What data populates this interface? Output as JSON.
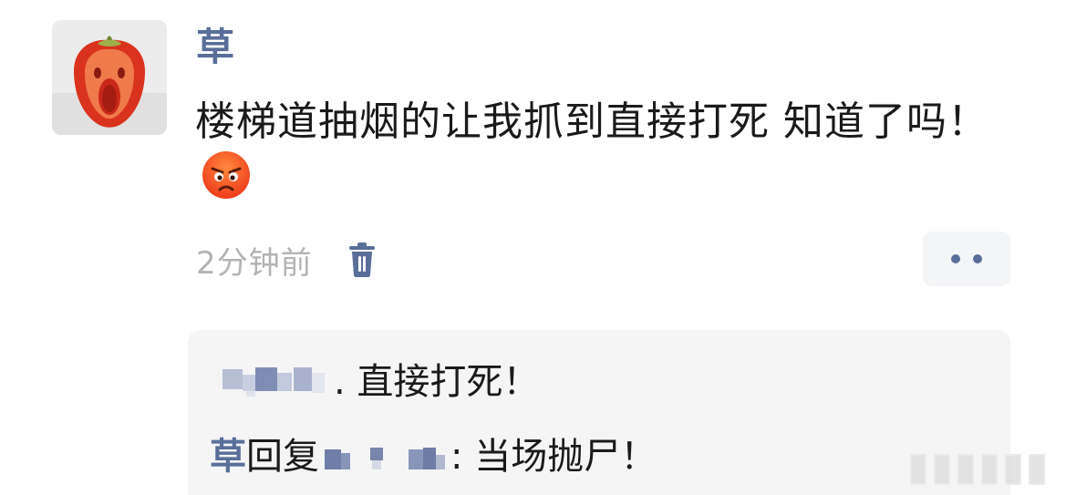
{
  "comment": {
    "author": "草",
    "text": "楼梯道抽烟的让我抓到直接打死 知道了吗！",
    "emoji": "angry-face-emoji",
    "time": "2分钟前"
  },
  "actions": {
    "delete_icon": "trash-icon",
    "more_icon": "more-dots-icon"
  },
  "replies": [
    {
      "text": ". 直接打死！"
    },
    {
      "author": "草",
      "verb": "回复",
      "text": ": 当场抛尸！"
    }
  ],
  "colors": {
    "author": "#5a6e9a",
    "time": "#b3b3b3",
    "reply_bg": "#f5f5f6",
    "text": "#1a1a1a"
  }
}
